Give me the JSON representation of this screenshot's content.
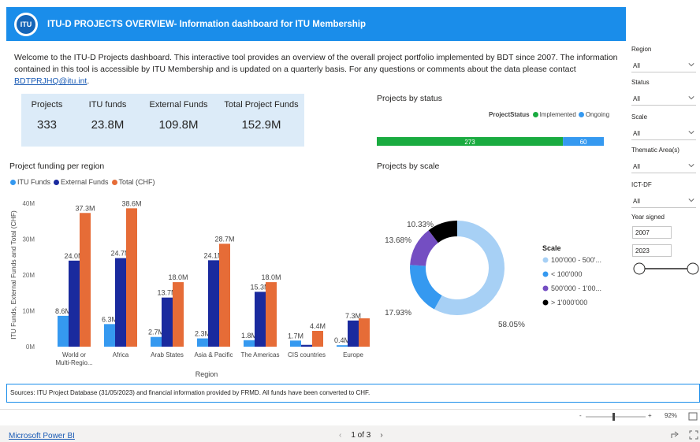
{
  "header": {
    "logo_text": "ITU",
    "title": "ITU-D PROJECTS OVERVIEW- Information dashboard for ITU Membership"
  },
  "welcome": {
    "text": "Welcome to the ITU-D Projects dashboard. This interactive tool provides an overview of the overall project portfolio implemented by BDT since 2007. The information contained in this tool is accessible by ITU Membership and is updated on a quarterly basis. For any questions or comments about the data please contact ",
    "email": "BDTPRJHQ@itu.int",
    "end": "."
  },
  "kpis": [
    {
      "label": "Projects",
      "value": "333"
    },
    {
      "label": "ITU funds",
      "value": "23.8M"
    },
    {
      "label": "External Funds",
      "value": "109.8M"
    },
    {
      "label": "Total Project Funds",
      "value": "152.9M"
    }
  ],
  "region_chart": {
    "title": "Project funding per region",
    "legend": [
      "ITU Funds",
      "External Funds",
      "Total (CHF)"
    ],
    "ylabel": "ITU Funds, External Funds and Total (CHF)",
    "xlabel": "Region",
    "yticks": [
      "0M",
      "10M",
      "20M",
      "30M",
      "40M"
    ]
  },
  "status_chart": {
    "title": "Projects by status",
    "legend_title": "ProjectStatus",
    "legend": [
      "Implemented",
      "Ongoing"
    ],
    "labels": [
      "273",
      "60"
    ]
  },
  "scale_chart": {
    "title": "Projects by scale",
    "legend_title": "Scale",
    "legend": [
      "100'000 - 500'...",
      "< 100'000",
      "500'000 - 1'00...",
      "> 1'000'000"
    ],
    "slice_labels": [
      "58.05%",
      "17.93%",
      "13.68%",
      "10.33%"
    ]
  },
  "chart_data": [
    {
      "type": "bar",
      "title": "Project funding per region",
      "xlabel": "Region",
      "ylabel": "ITU Funds, External Funds and Total (CHF)",
      "ylim": [
        0,
        40
      ],
      "categories": [
        "World or Multi-Regio...",
        "Africa",
        "Arab States",
        "Asia & Pacific",
        "The Americas",
        "CIS countries",
        "Europe"
      ],
      "series": [
        {
          "name": "ITU Funds",
          "values": [
            8.6,
            6.3,
            2.7,
            2.3,
            1.8,
            1.7,
            0.4
          ],
          "labels": [
            "8.6M",
            "6.3M",
            "2.7M",
            "2.3M",
            "1.8M",
            "1.7M",
            "0.4M"
          ]
        },
        {
          "name": "External Funds",
          "values": [
            24.0,
            24.7,
            13.7,
            24.1,
            15.3,
            0.5,
            7.3
          ],
          "labels": [
            "24.0M",
            "24.7M",
            "13.7M",
            "24.1M",
            "15.3M",
            "",
            "7.3M"
          ]
        },
        {
          "name": "Total (CHF)",
          "values": [
            37.3,
            38.6,
            18.0,
            28.7,
            18.0,
            4.4,
            7.9
          ],
          "labels": [
            "37.3M",
            "38.6M",
            "18.0M",
            "28.7M",
            "18.0M",
            "4.4M",
            ""
          ]
        }
      ],
      "colors": [
        "#3599f0",
        "#1a2a9e",
        "#e66c37"
      ],
      "legend_position": "top-left"
    },
    {
      "type": "bar",
      "title": "Projects by status",
      "orientation": "horizontal-stacked",
      "categories": [
        "Implemented",
        "Ongoing"
      ],
      "values": [
        273,
        60
      ],
      "colors": [
        "#1aab40",
        "#3599f0"
      ]
    },
    {
      "type": "pie",
      "title": "Projects by scale",
      "donut": true,
      "categories": [
        "100'000 - 500'...",
        "< 100'000",
        "500'000 - 1'00...",
        "> 1'000'000"
      ],
      "values": [
        58.05,
        17.93,
        13.68,
        10.33
      ],
      "colors": [
        "#a7d0f5",
        "#3599f0",
        "#744ec2",
        "#000000"
      ]
    }
  ],
  "slicers": [
    {
      "label": "Region",
      "value": "All"
    },
    {
      "label": "Status",
      "value": "All"
    },
    {
      "label": "Scale",
      "value": "All"
    },
    {
      "label": "Thematic Area(s)",
      "value": "All"
    },
    {
      "label": "ICT-DF",
      "value": "All"
    }
  ],
  "year_signed": {
    "label": "Year signed",
    "from": "2007",
    "to": "2023"
  },
  "sources": "Sources: ITU Project Database (31/05/2023) and financial information provided by FRMD. All funds have been converted to CHF.",
  "zoom": {
    "minus": "-",
    "plus": "+",
    "level": "92%"
  },
  "footer": {
    "brand": "Microsoft Power BI",
    "page": "1 of 3",
    "prev": "‹",
    "next": "›"
  }
}
